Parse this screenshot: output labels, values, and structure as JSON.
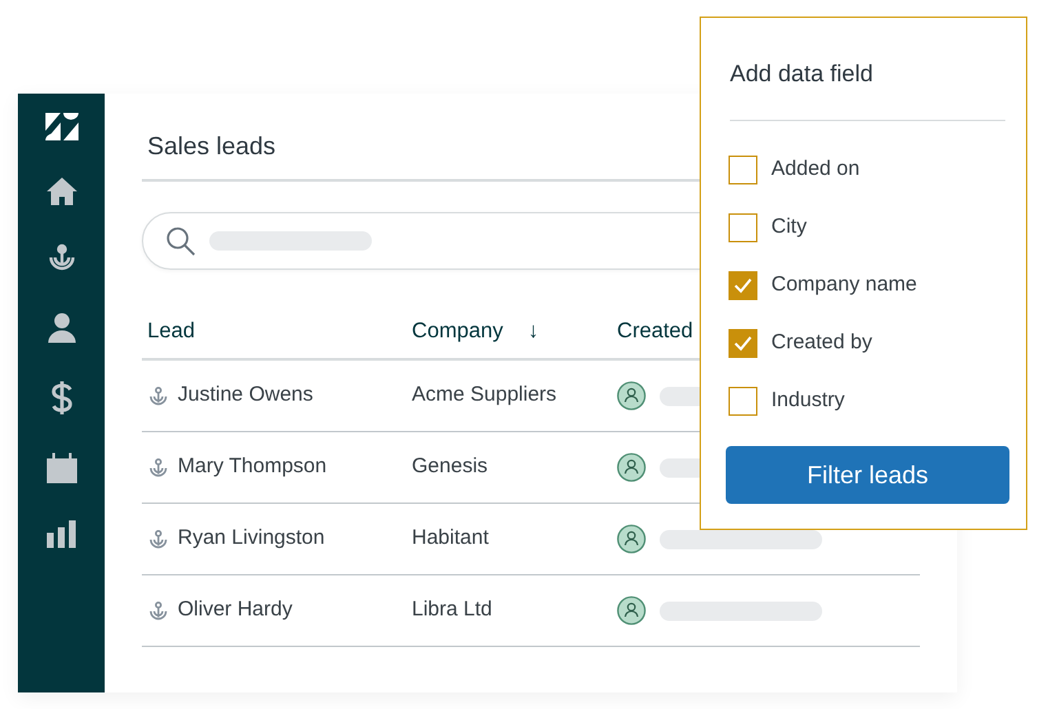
{
  "page": {
    "title": "Sales leads"
  },
  "table": {
    "columns": [
      {
        "label": "Lead"
      },
      {
        "label": "Company",
        "sort": "↓"
      },
      {
        "label": "Created"
      }
    ],
    "rows": [
      {
        "lead": "Justine Owens",
        "company": "Acme Suppliers"
      },
      {
        "lead": "Mary Thompson",
        "company": "Genesis"
      },
      {
        "lead": "Ryan Livingston",
        "company": "Habitant"
      },
      {
        "lead": "Oliver Hardy",
        "company": "Libra Ltd"
      }
    ]
  },
  "popup": {
    "title": "Add data field",
    "options": [
      {
        "label": "Added on",
        "checked": false
      },
      {
        "label": "City",
        "checked": false
      },
      {
        "label": "Company name",
        "checked": true
      },
      {
        "label": "Created by",
        "checked": true
      },
      {
        "label": "Industry",
        "checked": false
      }
    ],
    "button": "Filter leads"
  }
}
